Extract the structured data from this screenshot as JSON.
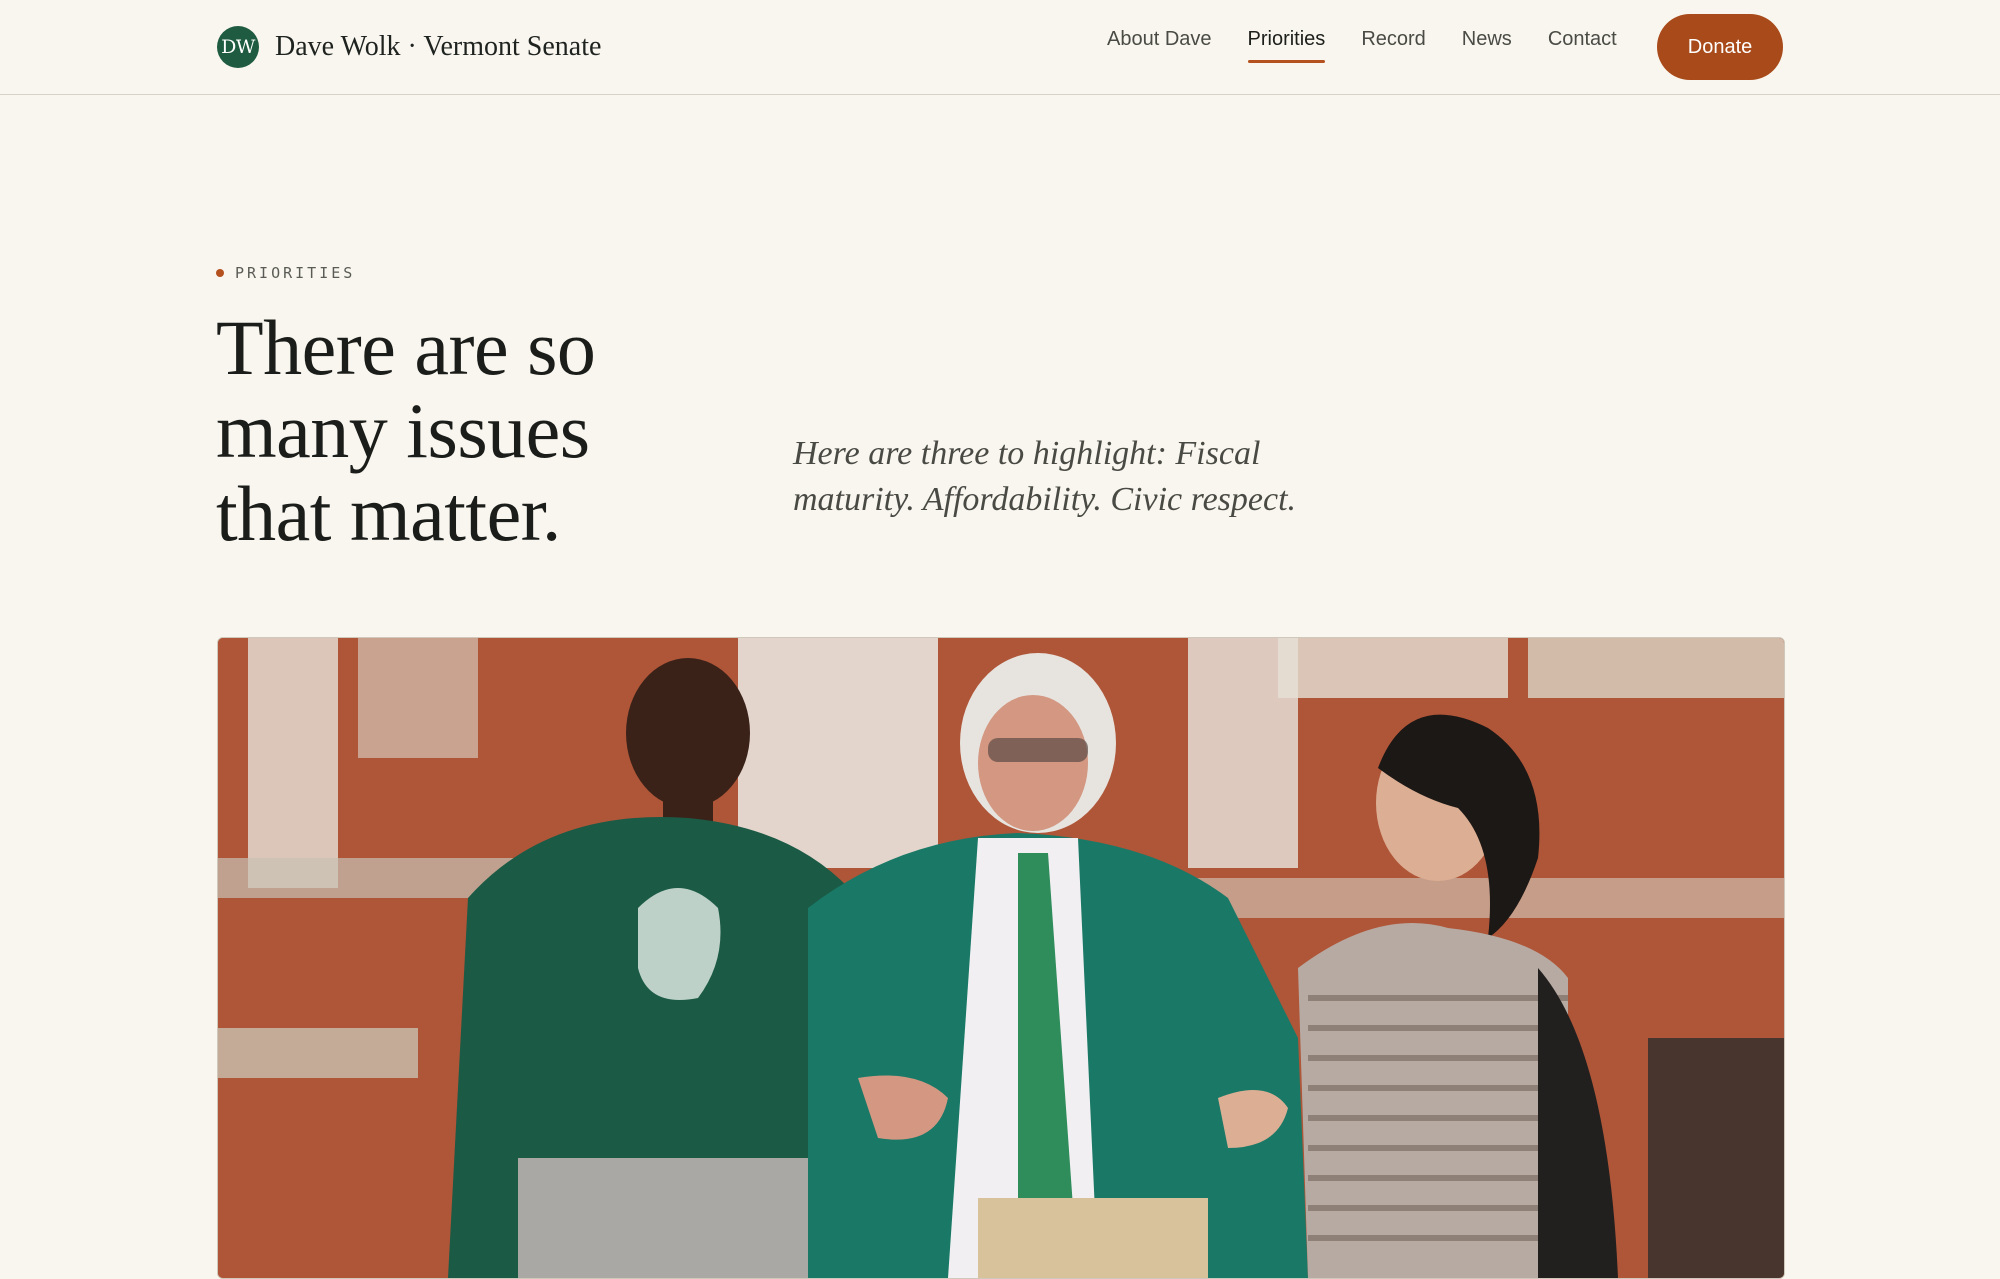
{
  "header": {
    "logo_initials": "DW",
    "brand_name": "Dave Wolk · Vermont Senate",
    "nav": [
      {
        "label": "About Dave",
        "active": false
      },
      {
        "label": "Priorities",
        "active": true
      },
      {
        "label": "Record",
        "active": false
      },
      {
        "label": "News",
        "active": false
      },
      {
        "label": "Contact",
        "active": false
      }
    ],
    "donate_label": "Donate"
  },
  "hero": {
    "eyebrow": "PRIORITIES",
    "headline_lines": [
      "There are so",
      "many issues",
      "that matter."
    ],
    "lead_lines": [
      "Here are three to highlight: Fiscal",
      "maturity. Affordability. Civic respect."
    ]
  },
  "photo": {
    "subject": "three-people-talking-photo"
  },
  "colors": {
    "background": "#f9f6ef",
    "brand_green": "#1e5b40",
    "accent": "#a84a19",
    "text": "#1d1f1b"
  }
}
